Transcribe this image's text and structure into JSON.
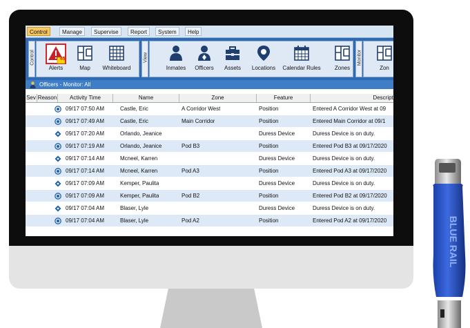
{
  "menu": [
    {
      "label": "Control",
      "active": true
    },
    {
      "label": "Manage"
    },
    {
      "label": "Supervise"
    },
    {
      "label": "Report"
    },
    {
      "label": "System"
    },
    {
      "label": "Help"
    }
  ],
  "ribbon": {
    "groups": {
      "control": "Control",
      "view": "View",
      "monitor": "Monitor"
    },
    "alerts_badge": "45",
    "buttons": {
      "alerts": "Alerts",
      "map": "Map",
      "whiteboard": "Whiteboard",
      "inmates": "Inmates",
      "officers": "Officers",
      "assets": "Assets",
      "locations": "Locations",
      "calendar_rules": "Calendar Rules",
      "zones": "Zones",
      "zone_partial": "Zon"
    }
  },
  "filter_text": "Officers - Monitor: All",
  "columns": [
    "Sev",
    "Reason",
    "Activity Time",
    "Name",
    "Zone",
    "Feature",
    "Descriptio"
  ],
  "rows": [
    {
      "reason": "position",
      "time": "09/17 07:50 AM",
      "name": "Castle, Eric",
      "zone": "A Corridor West",
      "feature": "Position",
      "desc": "Entered A Corridor West at 09"
    },
    {
      "reason": "position",
      "time": "09/17 07:49 AM",
      "name": "Castle, Eric",
      "zone": "Main Corridor",
      "feature": "Position",
      "desc": "Entered Main Corridor at 09/1"
    },
    {
      "reason": "duress",
      "time": "09/17 07:20 AM",
      "name": "Orlando, Jeanice",
      "zone": "",
      "feature": "Duress Device",
      "desc": "Duress Device is on duty."
    },
    {
      "reason": "position",
      "time": "09/17 07:19 AM",
      "name": "Orlando, Jeanice",
      "zone": "Pod B3",
      "feature": "Position",
      "desc": "Entered Pod B3 at 09/17/2020"
    },
    {
      "reason": "duress",
      "time": "09/17 07:14 AM",
      "name": "Mcneel, Karren",
      "zone": "",
      "feature": "Duress Device",
      "desc": "Duress Device is on duty."
    },
    {
      "reason": "position",
      "time": "09/17 07:14 AM",
      "name": "Mcneel, Karren",
      "zone": "Pod A3",
      "feature": "Position",
      "desc": "Entered Pod A3 at 09/17/2020"
    },
    {
      "reason": "duress",
      "time": "09/17 07:09 AM",
      "name": "Kemper, Paulita",
      "zone": "",
      "feature": "Duress Device",
      "desc": "Duress Device is on duty."
    },
    {
      "reason": "position",
      "time": "09/17 07:09 AM",
      "name": "Kemper, Paulita",
      "zone": "Pod B2",
      "feature": "Position",
      "desc": "Entered Pod B2 at 09/17/2020"
    },
    {
      "reason": "duress",
      "time": "09/17 07:04 AM",
      "name": "Blaser, Lyle",
      "zone": "",
      "feature": "Duress Device",
      "desc": "Duress Device is on duty."
    },
    {
      "reason": "position",
      "time": "09/17 07:04 AM",
      "name": "Blaser, Lyle",
      "zone": "Pod A2",
      "feature": "Position",
      "desc": "Entered Pod A2 at 09/17/2020"
    }
  ],
  "device_label": "BLUE RAIL",
  "colors": {
    "accent": "#2f6bb3",
    "active_tab": "#f6c863",
    "row_alt": "#dde9f7",
    "alert_red": "#d8232a"
  }
}
